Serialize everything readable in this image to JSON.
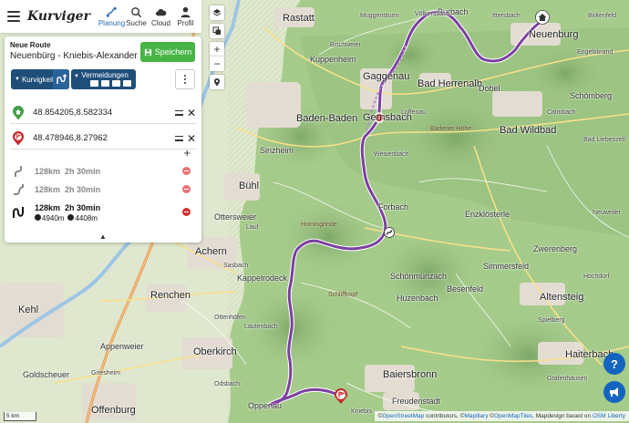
{
  "app": {
    "logo": "Kurviger"
  },
  "nav": [
    {
      "label": "Planung",
      "icon": "planning-icon",
      "active": true
    },
    {
      "label": "Suche",
      "icon": "search-icon",
      "active": false
    },
    {
      "label": "Cloud",
      "icon": "cloud-icon",
      "active": false
    },
    {
      "label": "Profil",
      "icon": "profile-icon",
      "active": false
    }
  ],
  "route": {
    "heading": "Neue Route",
    "name": "Neuenbürg - Kniebis-Alexanders...",
    "save_label": "Speichern"
  },
  "options": {
    "curvy_label": "Kurvigkeit",
    "avoid_label": "Vermeidungen"
  },
  "waypoints": [
    {
      "coord": "48.854205,8.582334",
      "pin": "start-pin-icon",
      "color": "#43a047"
    },
    {
      "coord": "48.478946,8.27962",
      "pin": "destination-pin-icon",
      "color": "#c62828"
    }
  ],
  "alternatives": [
    {
      "distance": "128km",
      "duration": "2h 30min"
    },
    {
      "distance": "128km",
      "duration": "2h 30min"
    },
    {
      "distance": "128km",
      "duration": "2h 30min",
      "ascent": "4940m",
      "descent": "4408m"
    }
  ],
  "map": {
    "places": {
      "rastatt": "Rastatt",
      "neuenburg": "Neuenburg",
      "gaggenau": "Gaggenau",
      "bad_herrenalb": "Bad Herrenalb",
      "baden_baden": "Baden-Baden",
      "gernsbach": "Gernsbach",
      "bad_wildbad": "Bad Wildbad",
      "buhl": "Bühl",
      "achern": "Achern",
      "renchen": "Renchen",
      "kehl": "Kehl",
      "oberkirch": "Oberkirch",
      "offenburg": "Offenburg",
      "altensteig": "Altensteig",
      "baiersbronn": "Baiersbronn",
      "haiterbach": "Haiterbach",
      "forbach": "Forbach",
      "dobel": "Dobel",
      "loffenau": "Loffenau",
      "weisenbach": "Weisenbach",
      "enzklosterle": "Enzklösterle",
      "schomberg": "Schömberg",
      "burbach": "Burbach",
      "ottersweier": "Ottersweier",
      "sasbach": "Sasbach",
      "kappelrodeck": "Kappelrodeck",
      "lauf": "Lauf",
      "sinzheim": "Sinzheim",
      "oppenau": "Oppenau",
      "kniebis": "Kniebis",
      "freudenstadt": "Freudenstadt",
      "schonmuenzach": "Schönmünzach",
      "huzenbach": "Huzenbach",
      "besenfeld": "Besenfeld",
      "simmersfeld": "Simmersfeld",
      "zwerenberg": "Zwerenberg",
      "spielberg": "Spielberg",
      "hochdorf": "Hochdorf",
      "grafenhausen": "Grafenhausen",
      "appenweier": "Appenweier",
      "goldscheuer": "Goldscheuer",
      "griesheim": "Griesheim",
      "odsbach": "Odsbach",
      "lautenbach": "Lautenbach",
      "ottenhofen": "Ottenhöfen",
      "bischweier": "Bischweier",
      "kuppenheim": "Kuppenheim",
      "muggensturm": "Muggensturm",
      "ittersbach": "Ittersbach",
      "birkenfeld": "Birkenfeld",
      "engelsbrand": "Engelsbrand",
      "bad_liebenzell": "Bad Liebenzell",
      "neuweiler": "Neuweiler",
      "calmbach": "Calmbach",
      "volkersbach": "Völkersbach",
      "hornisgrinde": "Hornisgrinde",
      "schliffkopf": "Schliffkopf",
      "badener_hohe": "Badener Höhe"
    },
    "scale": "5 km",
    "attribution_prefix": "©",
    "attribution_osm": "OpenStreetMap",
    "attribution_mid1": " contributors, ©",
    "attribution_mapillary": "Mapillary",
    "attribution_mid2": " ©",
    "attribution_omt": "OpenMapTiles",
    "attribution_mid3": ", Mapdesign based on ",
    "attribution_liberty": "OSM Liberty",
    "route_color": "#7b3fa0"
  },
  "help_label": "?"
}
